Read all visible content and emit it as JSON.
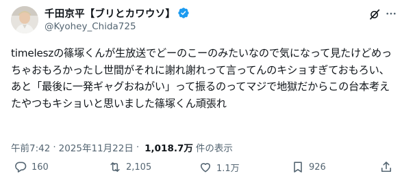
{
  "post": {
    "author_name": "千田京平【ブリとカワウソ】",
    "author_handle": "@Kyohey_Chida725",
    "text": "timeleszの篠塚くんが生放送でどーのこーのみたいなので気になって見たけどめっちゃおもろかったし世間がそれに謝れ謝れって言ってんのキショすぎておもろい、あと「最後に一発ギャグおねがい」って振るのってマジで地獄だからこの台本考えたやつもキショいと思いました篠塚くん頑張れ",
    "time": "午前7:42",
    "date": "2025年11月22日",
    "separator": "·",
    "views_count": "1,018.7万",
    "views_label": "件の表示"
  },
  "actions": {
    "reply_count": "160",
    "retweet_count": "2,105",
    "like_count": "1.1万",
    "bookmark_count": "926"
  },
  "icons": {
    "verified": "verified-badge-icon",
    "grok": "grok-icon",
    "more": "more-icon",
    "reply": "reply-icon",
    "retweet": "retweet-icon",
    "like": "heart-icon",
    "bookmark": "bookmark-icon",
    "share": "share-icon"
  },
  "colors": {
    "verified_blue": "#1d9bf0",
    "text_primary": "#0f1419",
    "text_secondary": "#536471"
  }
}
